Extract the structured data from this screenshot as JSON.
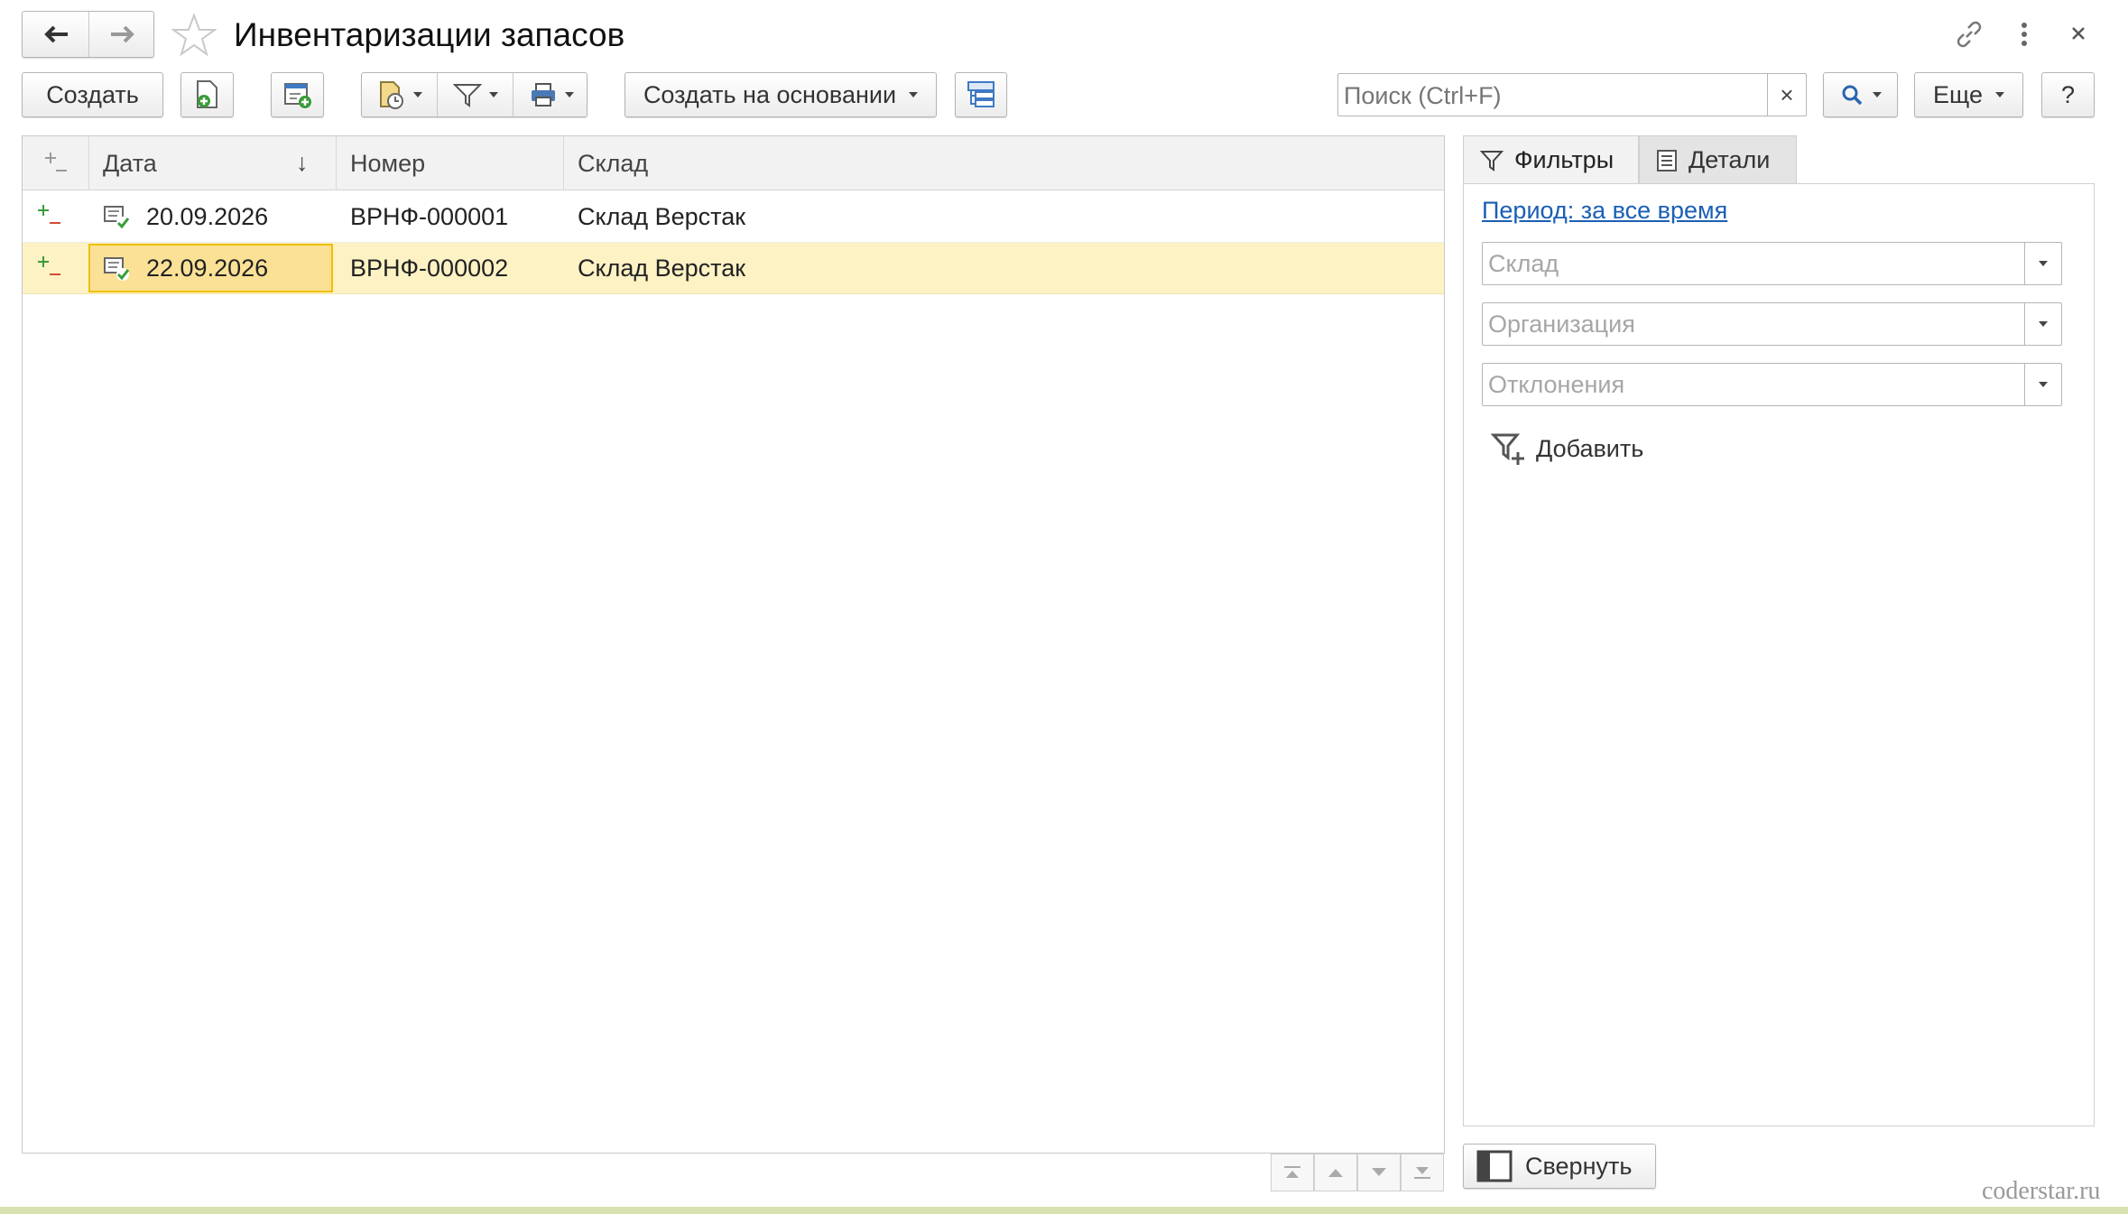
{
  "window": {
    "title": "Инвентаризации запасов"
  },
  "toolbar": {
    "create_label": "Создать",
    "create_based_label": "Создать на основании",
    "more_label": "Еще",
    "help_label": "?",
    "search_placeholder": "Поиск (Ctrl+F)",
    "search_clear": "×"
  },
  "table": {
    "columns": [
      "Дата",
      "Номер",
      "Склад"
    ],
    "sort_indicator": "↓",
    "rows": [
      {
        "date": "20.09.2026",
        "number": "ВРНФ-000001",
        "warehouse": "Склад Верстак",
        "selected": false
      },
      {
        "date": "22.09.2026",
        "number": "ВРНФ-000002",
        "warehouse": "Склад Верстак",
        "selected": true
      }
    ]
  },
  "panel": {
    "tabs": [
      {
        "label": "Фильтры",
        "active": true
      },
      {
        "label": "Детали",
        "active": false
      }
    ],
    "period_link": "Период: за все время",
    "filters": [
      {
        "placeholder": "Склад"
      },
      {
        "placeholder": "Организация"
      },
      {
        "placeholder": "Отклонения"
      }
    ],
    "add_label": "Добавить",
    "collapse_label": "Свернуть"
  },
  "watermark": "coderstar.ru",
  "colors": {
    "selected_row": "#fdf2c4",
    "selected_cell_border": "#f0c000",
    "link": "#1a5fb4",
    "green": "#3a9c3a"
  }
}
